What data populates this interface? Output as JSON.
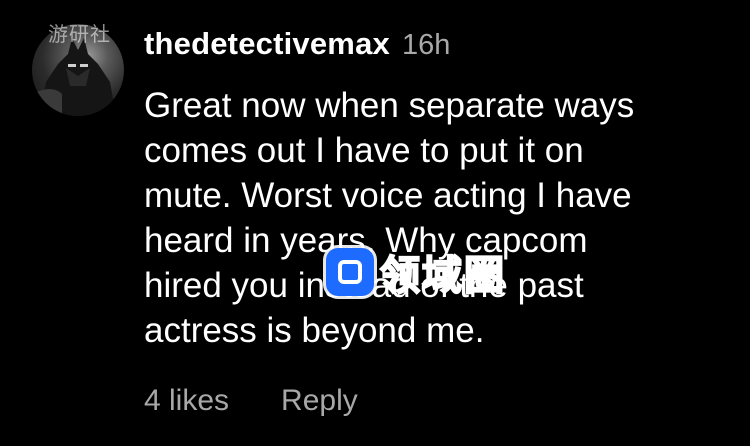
{
  "comment": {
    "username": "thedetectivemax",
    "time": "16h",
    "text": "Great now when separate ways\ncomes out I have to put it on\nmute. Worst voice acting I have\nheard in years. Why capcom\nhired you instead of the past\nactress is beyond me.",
    "likes": "4 likes",
    "reply_label": "Reply",
    "avatar_icon": "avatar-batman-icon"
  },
  "overlays": {
    "corner_watermark": "游研社",
    "center_watermark": "领域圈",
    "watermark_color": "#1e6bff"
  },
  "colors": {
    "background": "#000000",
    "primary_text": "#ffffff",
    "secondary_text": "#a8a8a8"
  }
}
